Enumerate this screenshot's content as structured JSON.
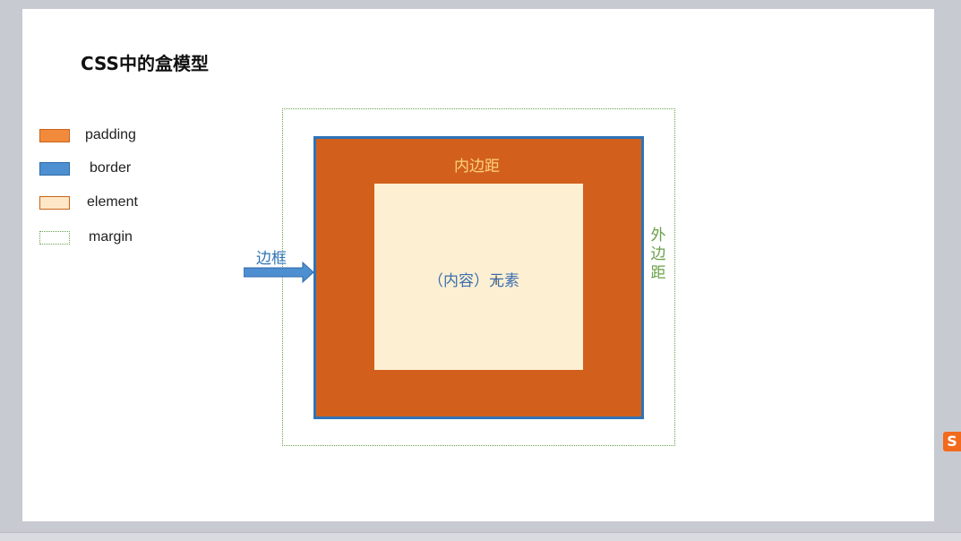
{
  "slide": {
    "title": "CSS中的盒模型"
  },
  "legend": [
    {
      "label": "padding",
      "swatch": "padding",
      "color": "#f28a3c"
    },
    {
      "label": "border",
      "swatch": "border",
      "color": "#4e8fd1"
    },
    {
      "label": "element",
      "swatch": "element",
      "color": "#fde7c6"
    },
    {
      "label": "margin",
      "swatch": "margin",
      "color": "#6aa04a"
    }
  ],
  "diagram": {
    "padding_label": "内边距",
    "content_label": "（内容）元素",
    "border_label": "边框",
    "margin_label": "外边距",
    "cursor_glyph": "I"
  },
  "ime": {
    "glyph": "S",
    "icon": "sogou-ime-icon"
  },
  "colors": {
    "padding_fill": "#d2601c",
    "border_stroke": "#2f73b8",
    "content_fill": "#fdefd2",
    "margin_stroke": "#6aa04a"
  }
}
